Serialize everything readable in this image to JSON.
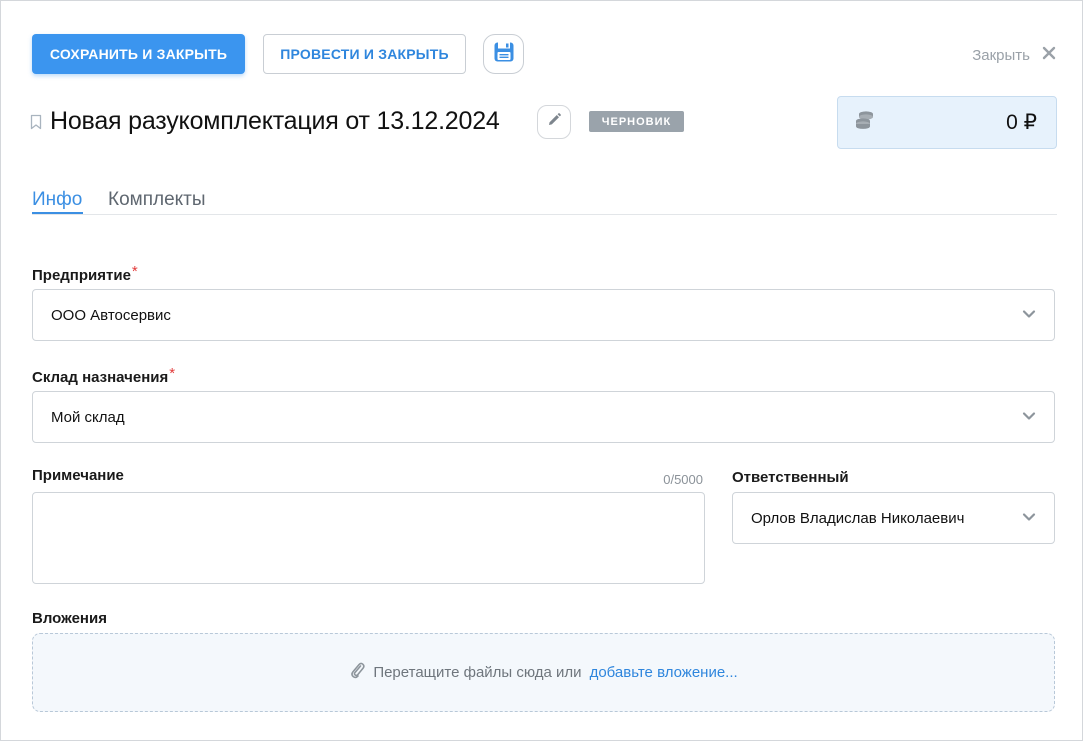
{
  "toolbar": {
    "save_close_label": "СОХРАНИТЬ И ЗАКРЫТЬ",
    "post_close_label": "ПРОВЕСТИ И ЗАКРЫТЬ",
    "save_icon": "floppy-disk-icon",
    "close_label": "Закрыть",
    "close_icon": "close-icon"
  },
  "header": {
    "title": "Новая разукомплектация от 13.12.2024",
    "status": "ЧЕРНОВИК",
    "sum": "0 ₽",
    "sum_icon": "coins-icon"
  },
  "tabs": [
    {
      "label": "Инфо",
      "active": true
    },
    {
      "label": "Комплекты",
      "active": false
    }
  ],
  "form": {
    "enterprise": {
      "label": "Предприятие",
      "required_mark": "*",
      "value": "ООО Автосервис"
    },
    "warehouse": {
      "label": "Склад назначения",
      "required_mark": "*",
      "value": "Мой склад"
    },
    "note": {
      "label": "Примечание",
      "value": "",
      "counter": "0/5000"
    },
    "responsible": {
      "label": "Ответственный",
      "value": "Орлов Владислав Николаевич"
    },
    "attachments": {
      "label": "Вложения",
      "drop_text": "Перетащите файлы сюда или",
      "drop_link": "добавьте вложение..."
    }
  },
  "colors": {
    "primary": "#3b95ef",
    "link": "#2f86dd",
    "status_badge": "#9aa3ab",
    "sum_bg": "#e7f2fc",
    "required": "#e23b3b"
  }
}
